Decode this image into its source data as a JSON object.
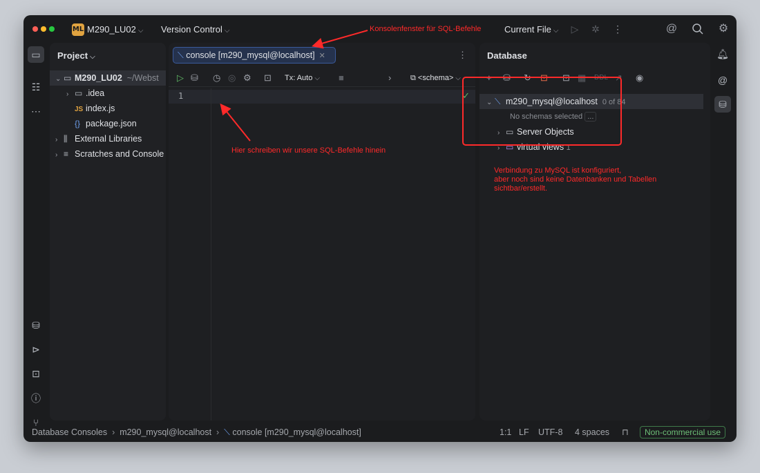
{
  "titlebar": {
    "project_badge": "ML",
    "project_name": "M290_LU02",
    "version_control": "Version Control",
    "run_config": "Current File",
    "icons": [
      "play-icon",
      "debug-icon",
      "more-icon",
      "ai-spiral-icon",
      "search-icon",
      "settings-gear-icon"
    ]
  },
  "left_strip": {
    "icons": [
      "folder-icon",
      "structure-icon",
      "more-dots-icon",
      "database-icon",
      "services-icon",
      "terminal-icon",
      "problems-icon",
      "git-icon"
    ]
  },
  "right_strip": {
    "icons": [
      "notifications-icon",
      "ai-chat-icon",
      "database-icon"
    ]
  },
  "project_panel": {
    "title": "Project",
    "root": {
      "name": "M290_LU02",
      "path": "~/Webst"
    },
    "items": [
      {
        "label": ".idea",
        "icon": "folder-icon"
      },
      {
        "label": "index.js",
        "icon": "js-file-icon"
      },
      {
        "label": "package.json",
        "icon": "json-file-icon"
      },
      {
        "label": "External Libraries",
        "icon": "library-icon"
      },
      {
        "label": "Scratches and Console",
        "icon": "scratches-icon"
      }
    ]
  },
  "editor": {
    "tab_label": "console [m290_mysql@localhost]",
    "tx_mode": "Tx: Auto",
    "schema_selector": "<schema>",
    "line_number": "1"
  },
  "database_panel": {
    "title": "Database",
    "ddl_label": "DDL",
    "connection": {
      "name": "m290_mysql@localhost",
      "count": "0 of 84"
    },
    "no_schemas": "No schemas selected",
    "ellipsis": "...",
    "children": [
      {
        "label": "Server Objects",
        "count": ""
      },
      {
        "label": "virtual views",
        "count": "1"
      }
    ]
  },
  "annotations": {
    "console_window": "Konsolenfenster für SQL-Befehle",
    "write_here": "Hier schreiben wir unsere SQL-Befehle hinein",
    "connection_note": [
      "Verbindung zu MySQL ist konfiguriert,",
      "aber noch sind keine Datenbanken und Tabellen",
      "sichtbar/erstellt."
    ],
    "color": "#ff2a2a"
  },
  "statusbar": {
    "breadcrumb": [
      "Database Consoles",
      "m290_mysql@localhost",
      "console [m290_mysql@localhost]"
    ],
    "position": "1:1",
    "line_ending": "LF",
    "encoding": "UTF-8",
    "indent": "4 spaces",
    "license": "Non-commercial use"
  },
  "colors": {
    "accent_tab": "#25324d",
    "annotation_red": "#ff2a2a",
    "success_green": "#5fb865"
  }
}
